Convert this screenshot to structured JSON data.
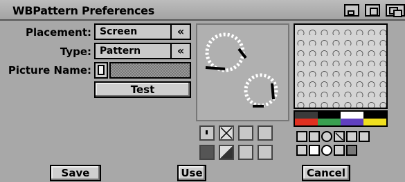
{
  "window": {
    "title": "WBPattern Preferences"
  },
  "form": {
    "placement_label": "Placement:",
    "placement_value": "Screen",
    "type_label": "Type:",
    "type_value": "Pattern",
    "picture_label": "Picture Name:",
    "cycle_glyph": "«",
    "test_label": "Test"
  },
  "palette": {
    "colors": [
      "#3a3a3a",
      "#000000",
      "#ffffff",
      "#000000",
      "#e03020",
      "#39a050",
      "#6040c0",
      "#f0e020"
    ]
  },
  "footer": {
    "save_label": "Save",
    "use_label": "Use",
    "cancel_label": "Cancel"
  }
}
